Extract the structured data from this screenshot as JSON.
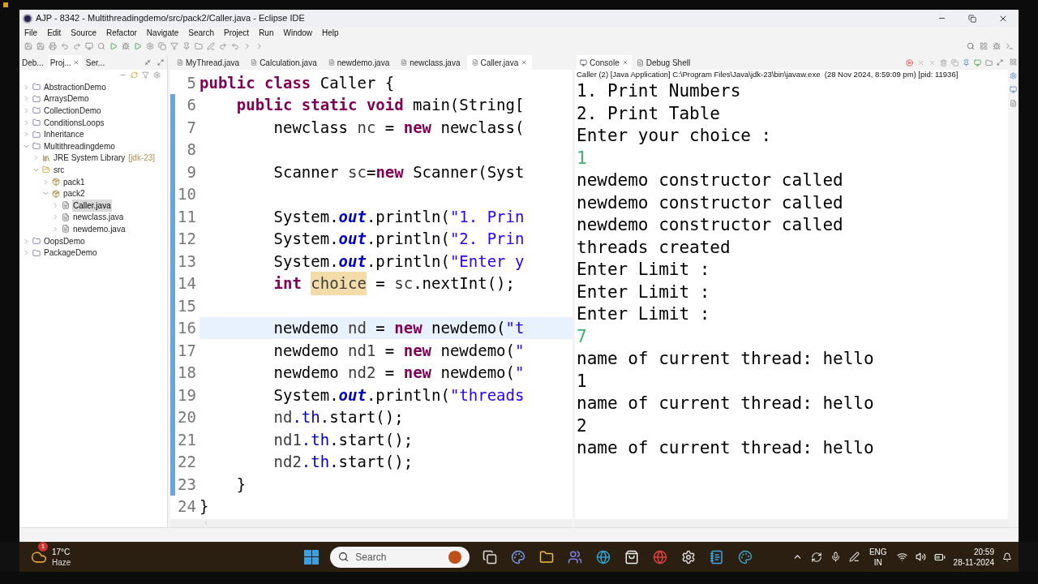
{
  "window": {
    "title": "AJP - 8342 - Multithreadingdemo/src/pack2/Caller.java - Eclipse IDE"
  },
  "menu": [
    "File",
    "Edit",
    "Source",
    "Refactor",
    "Navigate",
    "Search",
    "Project",
    "Run",
    "Window",
    "Help"
  ],
  "left_panel": {
    "tabs": [
      {
        "label": "Deb...",
        "selected": false
      },
      {
        "label": "Proj...",
        "selected": true
      },
      {
        "label": "Ser...",
        "selected": false
      }
    ],
    "tree": [
      {
        "label": "AbstractionDemo",
        "kind": "project",
        "expanded": false,
        "selected": false
      },
      {
        "label": "ArraysDemo",
        "kind": "project",
        "expanded": false,
        "selected": false
      },
      {
        "label": "CollectionDemo",
        "kind": "project",
        "expanded": false,
        "selected": false
      },
      {
        "label": "ConditionsLoops",
        "kind": "project",
        "expanded": false,
        "selected": false
      },
      {
        "label": "Inheritance",
        "kind": "project",
        "expanded": false,
        "selected": false
      },
      {
        "label": "Multithreadingdemo",
        "kind": "project",
        "expanded": true,
        "selected": false,
        "children": [
          {
            "label": "JRE System Library",
            "decoration": "[jdk-23]",
            "kind": "library",
            "expanded": false,
            "selected": false
          },
          {
            "label": "src",
            "kind": "folder",
            "expanded": true,
            "selected": false,
            "children": [
              {
                "label": "pack1",
                "kind": "package",
                "expanded": false,
                "selected": false
              },
              {
                "label": "pack2",
                "kind": "package",
                "expanded": true,
                "selected": false,
                "children": [
                  {
                    "label": "Caller.java",
                    "kind": "file",
                    "expanded": false,
                    "selected": true
                  },
                  {
                    "label": "newclass.java",
                    "kind": "file",
                    "expanded": false,
                    "selected": false
                  },
                  {
                    "label": "newdemo.java",
                    "kind": "file",
                    "expanded": false,
                    "selected": false
                  }
                ]
              }
            ]
          }
        ]
      },
      {
        "label": "OopsDemo",
        "kind": "project",
        "expanded": false,
        "selected": false
      },
      {
        "label": "PackageDemo",
        "kind": "project",
        "expanded": false,
        "selected": false
      }
    ]
  },
  "editor": {
    "tabs": [
      {
        "label": "MyThread.java",
        "selected": false
      },
      {
        "label": "Calculation.java",
        "selected": false
      },
      {
        "label": "newdemo.java",
        "selected": false
      },
      {
        "label": "newclass.java",
        "selected": false
      },
      {
        "label": "Caller.java",
        "selected": true
      }
    ],
    "lines": [
      {
        "number": "5",
        "selected": false,
        "tokens": [
          {
            "text": "public class ",
            "kind": "kw"
          },
          {
            "text": "Caller {",
            "kind": "plain"
          }
        ]
      },
      {
        "number": "6",
        "selected": false,
        "tokens": [
          {
            "text": "    public static void ",
            "kind": "kw"
          },
          {
            "text": "main(String[",
            "kind": "plain"
          }
        ]
      },
      {
        "number": "7",
        "selected": false,
        "tokens": [
          {
            "text": "        newclass ",
            "kind": "plain"
          },
          {
            "text": "nc",
            "kind": "var"
          },
          {
            "text": " = ",
            "kind": "plain"
          },
          {
            "text": "new",
            "kind": "kw"
          },
          {
            "text": " newclass(",
            "kind": "plain"
          }
        ]
      },
      {
        "number": "8",
        "selected": false
      },
      {
        "number": "9",
        "selected": false,
        "tokens": [
          {
            "text": "        Scanner ",
            "kind": "plain"
          },
          {
            "text": "sc",
            "kind": "var"
          },
          {
            "text": "=",
            "kind": "plain"
          },
          {
            "text": "new",
            "kind": "kw"
          },
          {
            "text": " Scanner(Syst",
            "kind": "plain"
          }
        ]
      },
      {
        "number": "10",
        "selected": false
      },
      {
        "number": "11",
        "selected": false,
        "tokens": [
          {
            "text": "        System.",
            "kind": "plain"
          },
          {
            "text": "out",
            "kind": "field"
          },
          {
            "text": ".println(",
            "kind": "plain"
          },
          {
            "text": "\"1. Prin",
            "kind": "str"
          }
        ]
      },
      {
        "number": "12",
        "selected": false,
        "tokens": [
          {
            "text": "        System.",
            "kind": "plain"
          },
          {
            "text": "out",
            "kind": "field"
          },
          {
            "text": ".println(",
            "kind": "plain"
          },
          {
            "text": "\"2. Prin",
            "kind": "str"
          }
        ]
      },
      {
        "number": "13",
        "selected": false,
        "tokens": [
          {
            "text": "        System.",
            "kind": "plain"
          },
          {
            "text": "out",
            "kind": "field"
          },
          {
            "text": ".println(",
            "kind": "plain"
          },
          {
            "text": "\"Enter y",
            "kind": "str"
          }
        ]
      },
      {
        "number": "14",
        "selected": false,
        "tokens": [
          {
            "text": "        int ",
            "kind": "kw"
          },
          {
            "text": "choice",
            "kind": "mark"
          },
          {
            "text": " = ",
            "kind": "plain"
          },
          {
            "text": "sc",
            "kind": "var"
          },
          {
            "text": ".nextInt();",
            "kind": "plain"
          }
        ]
      },
      {
        "number": "15",
        "selected": false
      },
      {
        "number": "16",
        "selected": true,
        "tokens": [
          {
            "text": "        newdemo ",
            "kind": "plain"
          },
          {
            "text": "nd",
            "kind": "var"
          },
          {
            "text": " = ",
            "kind": "plain"
          },
          {
            "text": "new",
            "kind": "kw"
          },
          {
            "text": " newdemo(",
            "kind": "plain"
          },
          {
            "text": "\"t",
            "kind": "str"
          }
        ]
      },
      {
        "number": "17",
        "selected": false,
        "tokens": [
          {
            "text": "        newdemo ",
            "kind": "plain"
          },
          {
            "text": "nd1",
            "kind": "var"
          },
          {
            "text": " = ",
            "kind": "plain"
          },
          {
            "text": "new",
            "kind": "kw"
          },
          {
            "text": " newdemo(",
            "kind": "plain"
          },
          {
            "text": "\"",
            "kind": "str"
          }
        ]
      },
      {
        "number": "18",
        "selected": false,
        "tokens": [
          {
            "text": "        newdemo ",
            "kind": "plain"
          },
          {
            "text": "nd2",
            "kind": "var"
          },
          {
            "text": " = ",
            "kind": "plain"
          },
          {
            "text": "new",
            "kind": "kw"
          },
          {
            "text": " newdemo(",
            "kind": "plain"
          },
          {
            "text": "\"",
            "kind": "str"
          }
        ]
      },
      {
        "number": "19",
        "selected": false,
        "tokens": [
          {
            "text": "        System.",
            "kind": "plain"
          },
          {
            "text": "out",
            "kind": "field"
          },
          {
            "text": ".println(",
            "kind": "plain"
          },
          {
            "text": "\"threads",
            "kind": "str"
          }
        ]
      },
      {
        "number": "20",
        "selected": false,
        "tokens": [
          {
            "text": "        nd",
            "kind": "var"
          },
          {
            "text": ".th",
            "kind": "member"
          },
          {
            "text": ".start();",
            "kind": "plain"
          }
        ]
      },
      {
        "number": "21",
        "selected": false,
        "tokens": [
          {
            "text": "        nd1",
            "kind": "var"
          },
          {
            "text": ".th",
            "kind": "member"
          },
          {
            "text": ".start();",
            "kind": "plain"
          }
        ]
      },
      {
        "number": "22",
        "selected": false,
        "tokens": [
          {
            "text": "        nd2",
            "kind": "var"
          },
          {
            "text": ".th",
            "kind": "member"
          },
          {
            "text": ".start();",
            "kind": "plain"
          }
        ]
      },
      {
        "number": "23",
        "selected": false,
        "tokens": [
          {
            "text": "    }",
            "kind": "plain"
          }
        ]
      },
      {
        "number": "24",
        "selected": false,
        "tokens": [
          {
            "text": "}",
            "kind": "plain"
          }
        ]
      }
    ]
  },
  "console": {
    "tabs": [
      {
        "label": "Console",
        "selected": true
      },
      {
        "label": "Debug Shell",
        "selected": false
      }
    ],
    "process": "Caller (2) [Java Application] C:\\Program Files\\Java\\jdk-23\\bin\\javaw.exe  (28 Nov 2024, 8:59:09 pm) [pid: 11936]",
    "lines": [
      {
        "text": "1. Print Numbers",
        "kind": "output"
      },
      {
        "text": "2. Print Table",
        "kind": "output"
      },
      {
        "text": "Enter your choice :",
        "kind": "output"
      },
      {
        "text": "1",
        "kind": "input"
      },
      {
        "text": "newdemo constructor called",
        "kind": "output"
      },
      {
        "text": "newdemo constructor called",
        "kind": "output"
      },
      {
        "text": "newdemo constructor called",
        "kind": "output"
      },
      {
        "text": "threads created",
        "kind": "output"
      },
      {
        "text": "Enter Limit :",
        "kind": "output"
      },
      {
        "text": "Enter Limit :",
        "kind": "output"
      },
      {
        "text": "Enter Limit :",
        "kind": "output"
      },
      {
        "text": "7",
        "kind": "input"
      },
      {
        "text": "name of current thread: hello",
        "kind": "output"
      },
      {
        "text": "1",
        "kind": "output"
      },
      {
        "text": "name of current thread: hello",
        "kind": "output"
      },
      {
        "text": "2",
        "kind": "output"
      },
      {
        "text": "name of current thread: hello",
        "kind": "output"
      }
    ]
  },
  "taskbar": {
    "weather": {
      "temperature": "17°C",
      "condition": "Haze",
      "badge": "1"
    },
    "search": {
      "placeholder": "Search"
    },
    "language": {
      "code": "ENG",
      "region": "IN"
    },
    "clock": {
      "time": "20:59",
      "date": "28-11-2024"
    }
  }
}
